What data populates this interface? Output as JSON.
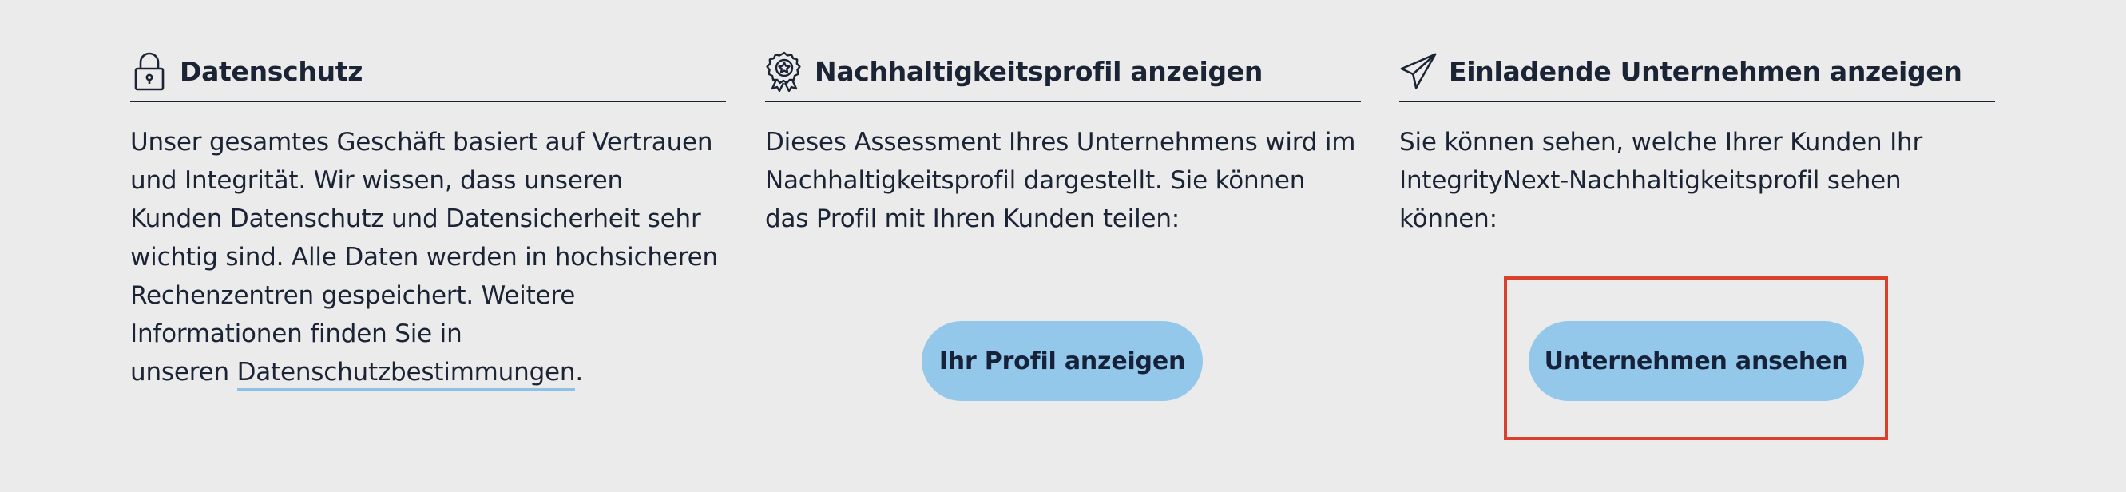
{
  "sections": [
    {
      "icon": "lock-icon",
      "title": "Datenschutz",
      "body": "Unser gesamtes Geschäft basiert auf Vertrauen\nund Integrität. Wir wissen, dass unseren\nKunden Datenschutz und Datensicherheit sehr\nwichtig sind. Alle Daten werden in hochsicheren\nRechenzentren gespeichert. Weitere\nInformationen finden Sie in\nunseren ",
      "link_text": "Datenschutzbestimmungen",
      "trailing": "."
    },
    {
      "icon": "award-badge-icon",
      "title": "Nachhaltigkeitsprofil anzeigen",
      "body": "Dieses Assessment Ihres Unternehmens wird im\nNachhaltigkeitsprofil dargestellt. Sie können\ndas Profil mit Ihren Kunden teilen:",
      "button_label": "Ihr Profil anzeigen"
    },
    {
      "icon": "paper-plane-icon",
      "title": "Einladende Unternehmen anzeigen",
      "body": "Sie können sehen, welche Ihrer Kunden Ihr\nIntegrityNext-Nachhaltigkeitsprofil sehen\nkönnen:",
      "button_label": "Unternehmen ansehen"
    }
  ],
  "colors": {
    "background": "#ebebeb",
    "text": "#1b2435",
    "button": "#93c8ea",
    "link_underline": "#8fc0e6",
    "highlight": "#d9412b"
  }
}
